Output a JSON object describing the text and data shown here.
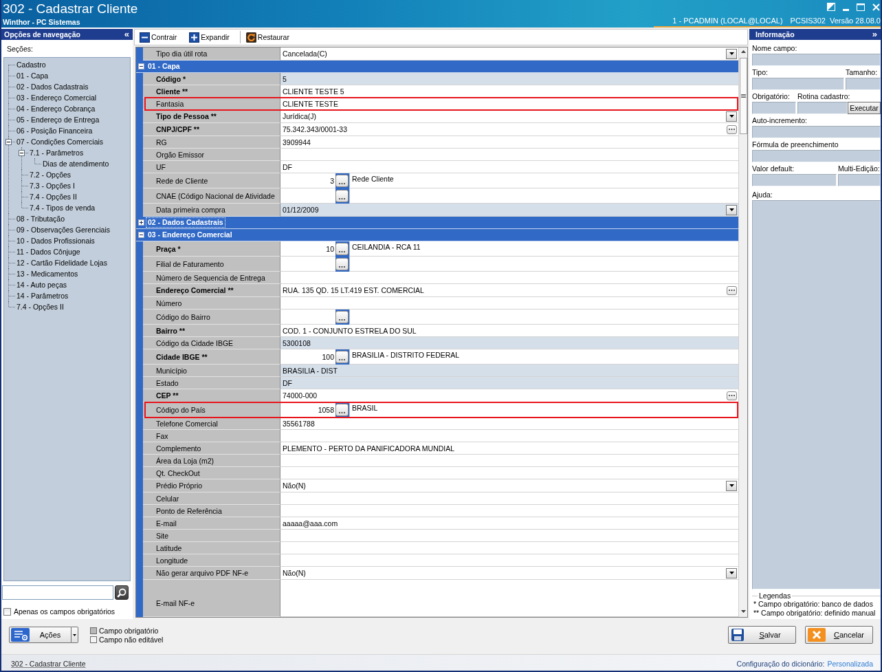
{
  "window": {
    "title": "302 - Cadastrar Cliente",
    "subtitle": "Winthor - PC Sistemas",
    "session": "1 - PCADMIN (LOCAL@LOCAL)",
    "program": "PCSIS302",
    "version": "Versão 28.08.0"
  },
  "navigation": {
    "title": "Opções de navegação",
    "collapse_glyph": "«",
    "sections_label": "Seções:",
    "tree": [
      {
        "label": "Cadastro"
      },
      {
        "label": "01 - Capa"
      },
      {
        "label": "02 - Dados Cadastrais"
      },
      {
        "label": "03 - Endereço Comercial"
      },
      {
        "label": "04 - Endereço Cobrança"
      },
      {
        "label": "05 - Endereço de Entrega"
      },
      {
        "label": "06 - Posição Financeira"
      },
      {
        "label": "07 - Condições Comerciais",
        "expanded": true,
        "children": [
          {
            "label": "7.1 - Parâmetros",
            "expanded": true,
            "children": [
              {
                "label": "Dias de atendimento"
              }
            ]
          },
          {
            "label": "7.2 - Opções"
          },
          {
            "label": "7.3 - Opções I"
          },
          {
            "label": "7.4 - Opções II"
          },
          {
            "label": "7.4 - Tipos de venda"
          }
        ]
      },
      {
        "label": "08 - Tributação"
      },
      {
        "label": "09 - Observações Gerenciais"
      },
      {
        "label": "10 - Dados Profissionais"
      },
      {
        "label": "11 - Dados Cônjuge"
      },
      {
        "label": "12 - Cartão Fidelidade Lojas"
      },
      {
        "label": "13 - Medicamentos"
      },
      {
        "label": "14 - Auto peças"
      },
      {
        "label": "14 - Parâmetros"
      },
      {
        "label": "7.4 - Opções II"
      }
    ],
    "only_required": {
      "label": "Apenas os campos obrigatórios",
      "checked": false
    }
  },
  "toolbar": [
    {
      "kind": "collapse",
      "label": "Contrair"
    },
    {
      "kind": "expand",
      "label": "Expandir"
    },
    {
      "kind": "restore",
      "label": "Restaurar"
    }
  ],
  "grid": {
    "rows": [
      {
        "kind": "dropdown",
        "label": "Tipo dia útil rota",
        "required": false,
        "readonly": false,
        "highlighted": false,
        "value": "Cancelada(C)"
      },
      {
        "kind": "section",
        "label": "01 - Capa",
        "expanded": true,
        "focused": false
      },
      {
        "kind": "text",
        "label": "Código *",
        "required": true,
        "readonly": true,
        "highlighted": false,
        "value": "5"
      },
      {
        "kind": "text",
        "label": "Cliente **",
        "required": true,
        "readonly": false,
        "highlighted": false,
        "value": "CLIENTE TESTE 5"
      },
      {
        "kind": "text",
        "label": "Fantasia",
        "required": false,
        "readonly": false,
        "highlighted": true,
        "value": "CLIENTE TESTE"
      },
      {
        "kind": "dropdown",
        "label": "Tipo de Pessoa **",
        "required": true,
        "readonly": false,
        "highlighted": false,
        "value": "Jurídica(J)"
      },
      {
        "kind": "ellipsis",
        "label": "CNPJ/CPF **",
        "required": true,
        "readonly": false,
        "highlighted": false,
        "value": "75.342.343/0001-33"
      },
      {
        "kind": "text",
        "label": "RG",
        "required": false,
        "readonly": false,
        "highlighted": false,
        "value": "3909944"
      },
      {
        "kind": "text",
        "label": "Orgão Emissor",
        "required": false,
        "readonly": false,
        "highlighted": false
      },
      {
        "kind": "text",
        "label": "UF",
        "required": false,
        "readonly": false,
        "highlighted": false,
        "value": "DF"
      },
      {
        "kind": "lookup",
        "label": "Rede de Cliente",
        "required": false,
        "readonly": false,
        "highlighted": false,
        "code": "3",
        "description": "Rede Cliente"
      },
      {
        "kind": "lookup",
        "label": "CNAE (Código Nacional de Atividade",
        "required": false,
        "readonly": false,
        "highlighted": false
      },
      {
        "kind": "dropdown",
        "label": "Data primeira compra",
        "required": false,
        "readonly": true,
        "highlighted": false,
        "value": "01/12/2009"
      },
      {
        "kind": "section",
        "label": "02 - Dados Cadastrais",
        "expanded": false,
        "focused": true
      },
      {
        "kind": "section",
        "label": "03 - Endereço Comercial",
        "expanded": true,
        "focused": false
      },
      {
        "kind": "lookup",
        "label": "Praça *",
        "required": true,
        "readonly": false,
        "highlighted": false,
        "code": "10",
        "description": "CEILANDIA - RCA 11"
      },
      {
        "kind": "lookup",
        "label": "Filial de Faturamento",
        "required": false,
        "readonly": false,
        "highlighted": false
      },
      {
        "kind": "text",
        "label": "Número de Sequencia de Entrega",
        "required": false,
        "readonly": false,
        "highlighted": false
      },
      {
        "kind": "ellipsis",
        "label": "Endereço Comercial **",
        "required": true,
        "readonly": false,
        "highlighted": false,
        "value": "RUA. 135 QD. 15 LT.419 EST. COMERCIAL"
      },
      {
        "kind": "text",
        "label": "Número",
        "required": false,
        "readonly": false,
        "highlighted": false
      },
      {
        "kind": "lookup",
        "label": "Código do Bairro",
        "required": false,
        "readonly": false,
        "highlighted": false
      },
      {
        "kind": "text",
        "label": "Bairro **",
        "required": true,
        "readonly": false,
        "highlighted": false,
        "value": "COD. 1 - CONJUNTO ESTRELA DO SUL"
      },
      {
        "kind": "text",
        "label": "Código da Cidade IBGE",
        "required": false,
        "readonly": true,
        "highlighted": false,
        "value": "5300108"
      },
      {
        "kind": "lookup",
        "label": "Cidade IBGE **",
        "required": true,
        "readonly": false,
        "highlighted": false,
        "code": "100",
        "description": "BRASILIA - DISTRITO FEDERAL"
      },
      {
        "kind": "text",
        "label": "Município",
        "required": false,
        "readonly": true,
        "highlighted": false,
        "value": "BRASILIA - DIST"
      },
      {
        "kind": "text",
        "label": "Estado",
        "required": false,
        "readonly": true,
        "highlighted": false,
        "value": "DF"
      },
      {
        "kind": "ellipsis",
        "label": "CEP **",
        "required": true,
        "readonly": false,
        "highlighted": false,
        "value": "74000-000"
      },
      {
        "kind": "lookup",
        "label": "Código do País",
        "required": false,
        "readonly": false,
        "highlighted": true,
        "code": "1058",
        "description": "BRASIL"
      },
      {
        "kind": "text",
        "label": "Telefone Comercial",
        "required": false,
        "readonly": false,
        "highlighted": false,
        "value": "35561788"
      },
      {
        "kind": "text",
        "label": "Fax",
        "required": false,
        "readonly": false,
        "highlighted": false
      },
      {
        "kind": "text",
        "label": "Complemento",
        "required": false,
        "readonly": false,
        "highlighted": false,
        "value": "PLEMENTO - PERTO DA PANIFICADORA MUNDIAL"
      },
      {
        "kind": "text",
        "label": "Área da Loja (m2)",
        "required": false,
        "readonly": false,
        "highlighted": false
      },
      {
        "kind": "text",
        "label": "Qt. CheckOut",
        "required": false,
        "readonly": false,
        "highlighted": false
      },
      {
        "kind": "dropdown",
        "label": "Prédio Próprio",
        "required": false,
        "readonly": false,
        "highlighted": false,
        "value": "Não(N)"
      },
      {
        "kind": "text",
        "label": "Celular",
        "required": false,
        "readonly": false,
        "highlighted": false
      },
      {
        "kind": "text",
        "label": "Ponto de Referência",
        "required": false,
        "readonly": false,
        "highlighted": false
      },
      {
        "kind": "text",
        "label": "E-mail",
        "required": false,
        "readonly": false,
        "highlighted": false,
        "value": "aaaaa@aaa.com"
      },
      {
        "kind": "text",
        "label": "Site",
        "required": false,
        "readonly": false,
        "highlighted": false
      },
      {
        "kind": "text",
        "label": "Latitude",
        "required": false,
        "readonly": false,
        "highlighted": false
      },
      {
        "kind": "text",
        "label": "Longitude",
        "required": false,
        "readonly": false,
        "highlighted": false
      },
      {
        "kind": "dropdown",
        "label": "Não gerar arquivo PDF NF-e",
        "required": false,
        "readonly": false,
        "highlighted": false,
        "value": "Não(N)"
      },
      {
        "kind": "memo",
        "label": "E-mail NF-e",
        "required": false,
        "readonly": false,
        "highlighted": false
      }
    ]
  },
  "information": {
    "title": "Informação",
    "expand_glyph": "»",
    "rows": [
      {
        "fields": [
          {
            "label": "Nome campo:"
          }
        ]
      },
      {
        "fields": [
          {
            "label": "Tipo:"
          },
          {
            "label": "Tamanho:"
          }
        ]
      },
      {
        "fields": [
          {
            "label": "Obrigatório:"
          },
          {
            "label": "Rotina cadastro:",
            "button": "Executar"
          }
        ]
      },
      {
        "fields": [
          {
            "label": "Auto-incremento:"
          }
        ]
      },
      {
        "fields": [
          {
            "label": "Fórmula de preenchimento"
          }
        ]
      },
      {
        "fields": [
          {
            "label": "Valor default:"
          },
          {
            "label": "Multi-Edição:"
          }
        ]
      }
    ],
    "help_label": "Ajuda:",
    "legend": {
      "title": "Legendas",
      "lines": [
        "* Campo obrigatório: banco de dados",
        "** Campo obrigatório: definido manual"
      ]
    }
  },
  "footer": {
    "actions_button": "Ações",
    "legend": [
      {
        "label": "Campo obrigatório",
        "color": "#b8b8b8"
      },
      {
        "label": "Campo não editável",
        "color": "#f4f4f4"
      }
    ],
    "save_button": "Salvar",
    "cancel_button": "Cancelar"
  },
  "status_bar": {
    "screen": "302 - Cadastrar Cliente",
    "dictionary_label": "Configuração do dicionário:",
    "dictionary_value": "Personalizada"
  }
}
